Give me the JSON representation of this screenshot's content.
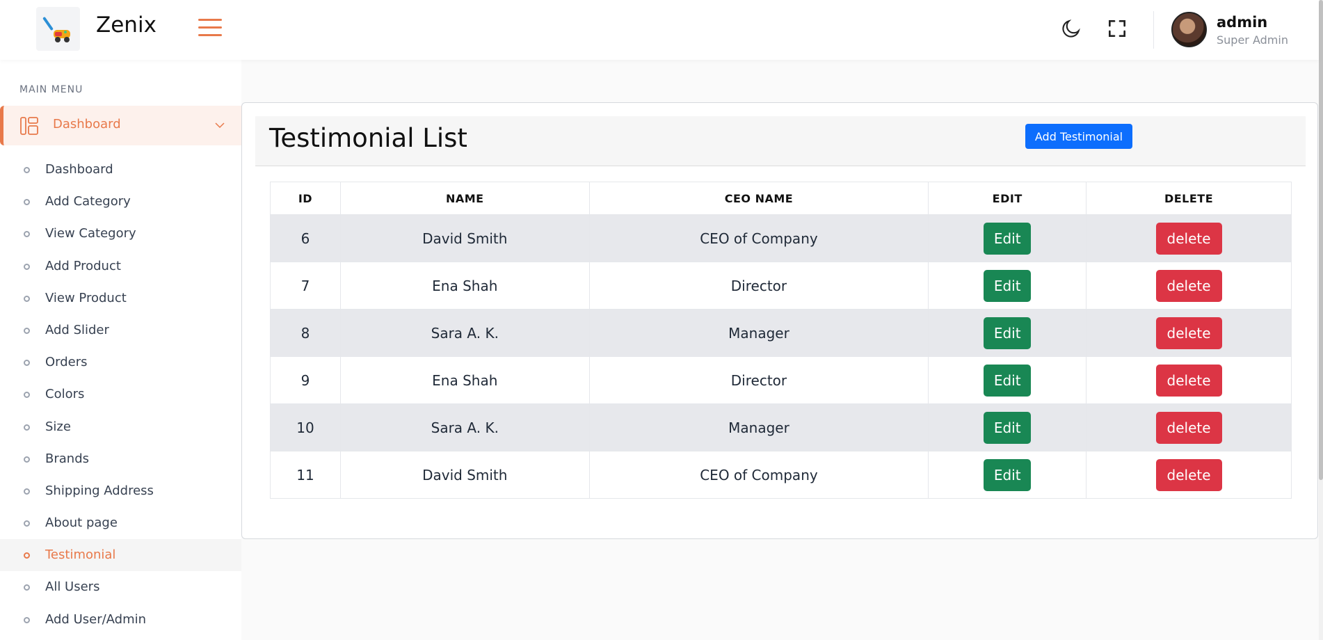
{
  "header": {
    "brand": "Zenix",
    "user_name": "admin",
    "user_role": "Super Admin",
    "icons": [
      "moon-icon",
      "fullscreen-icon"
    ]
  },
  "sidebar": {
    "menu_title": "MAIN MENU",
    "top_item": {
      "label": "Dashboard",
      "icon": "dashboard-layout-icon"
    },
    "items": [
      {
        "label": "Dashboard"
      },
      {
        "label": "Add Category"
      },
      {
        "label": "View Category"
      },
      {
        "label": "Add Product"
      },
      {
        "label": "View Product"
      },
      {
        "label": "Add Slider"
      },
      {
        "label": "Orders"
      },
      {
        "label": "Colors"
      },
      {
        "label": "Size"
      },
      {
        "label": "Brands"
      },
      {
        "label": "Shipping Address"
      },
      {
        "label": "About page"
      },
      {
        "label": "Testimonial",
        "active": true
      },
      {
        "label": "All Users"
      },
      {
        "label": "Add User/Admin"
      }
    ]
  },
  "main": {
    "title": "Testimonial List",
    "add_button": "Add Testimonial",
    "columns": [
      "ID",
      "NAME",
      "CEO NAME",
      "EDIT",
      "DELETE"
    ],
    "rows": [
      {
        "id": "6",
        "name": "David Smith",
        "ceo_name": "CEO of Company",
        "edit": "Edit",
        "delete": "delete"
      },
      {
        "id": "7",
        "name": "Ena Shah",
        "ceo_name": "Director",
        "edit": "Edit",
        "delete": "delete"
      },
      {
        "id": "8",
        "name": "Sara A. K.",
        "ceo_name": "Manager",
        "edit": "Edit",
        "delete": "delete"
      },
      {
        "id": "9",
        "name": "Ena Shah",
        "ceo_name": "Director",
        "edit": "Edit",
        "delete": "delete"
      },
      {
        "id": "10",
        "name": "Sara A. K.",
        "ceo_name": "Manager",
        "edit": "Edit",
        "delete": "delete"
      },
      {
        "id": "11",
        "name": "David Smith",
        "ceo_name": "CEO of Company",
        "edit": "Edit",
        "delete": "delete"
      }
    ]
  },
  "colors": {
    "accent": "#e8794a",
    "primary": "#0d6efd",
    "success": "#198754",
    "danger": "#dc3545"
  }
}
